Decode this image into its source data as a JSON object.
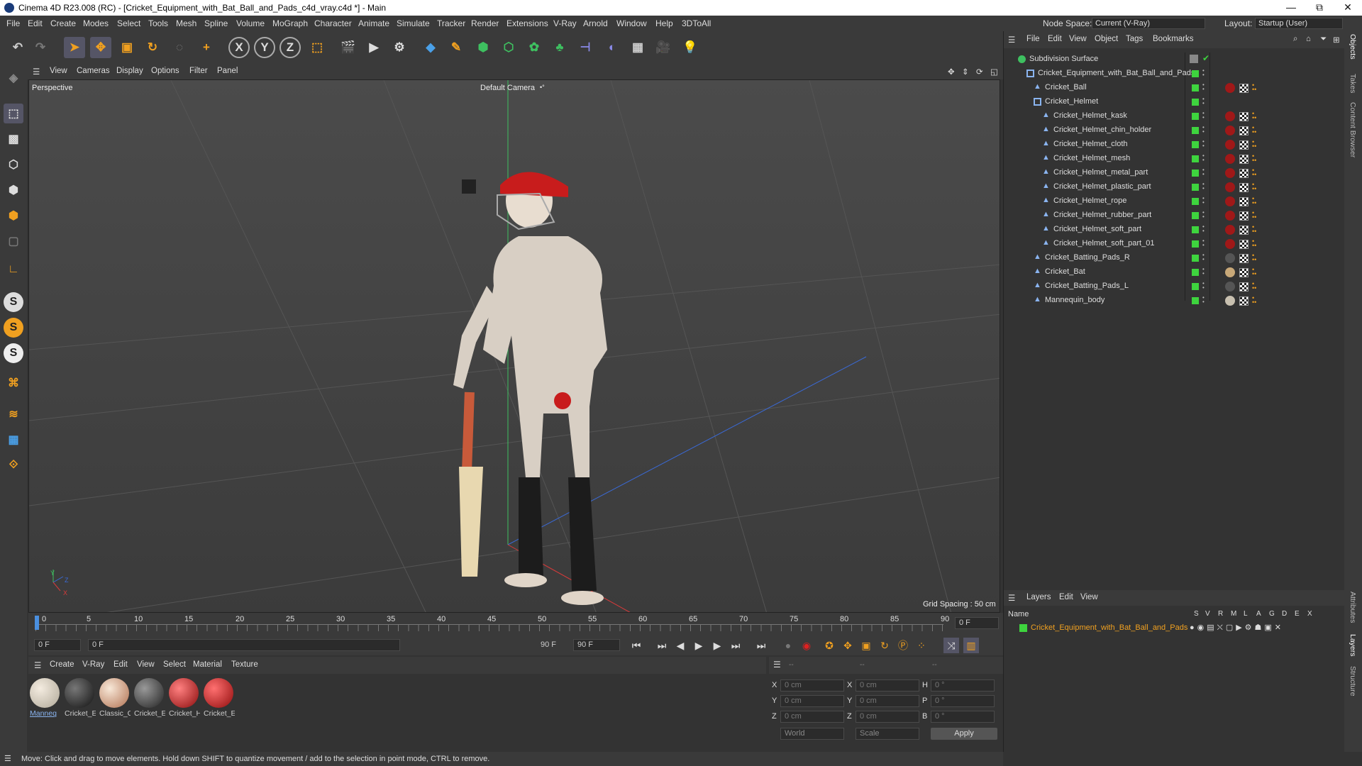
{
  "window": {
    "title": "Cinema 4D R23.008 (RC) - [Cricket_Equipment_with_Bat_Ball_and_Pads_c4d_vray.c4d *] - Main",
    "minimize": "—",
    "maximize": "⧉",
    "close": "✕"
  },
  "menu": {
    "items": [
      "File",
      "Edit",
      "Create",
      "Modes",
      "Select",
      "Tools",
      "Mesh",
      "Spline",
      "Volume",
      "MoGraph",
      "Character",
      "Animate",
      "Simulate",
      "Tracker",
      "Render",
      "Extensions",
      "V-Ray",
      "Arnold",
      "Window",
      "Help",
      "3DToAll"
    ],
    "node_space_label": "Node Space:",
    "node_space_value": "Current (V-Ray)",
    "layout_label": "Layout:",
    "layout_value": "Startup (User)"
  },
  "viewport": {
    "menu": [
      "View",
      "Cameras",
      "Display",
      "Options",
      "Filter",
      "Panel"
    ],
    "label": "Perspective",
    "camera": "Default Camera",
    "grid_spacing": "Grid Spacing : 50 cm",
    "axis_y": "Y",
    "axis_z": "Z",
    "axis_x": "X"
  },
  "timeline": {
    "ticks": [
      "0",
      "5",
      "10",
      "15",
      "20",
      "25",
      "30",
      "35",
      "40",
      "45",
      "50",
      "55",
      "60",
      "65",
      "70",
      "75",
      "80",
      "85",
      "90"
    ],
    "current_frame": "0 F"
  },
  "transport": {
    "start": "0 F",
    "range_start": "0 F",
    "range_end": "90 F",
    "end": "90 F"
  },
  "materials": {
    "menu": [
      "Create",
      "V-Ray",
      "Edit",
      "View",
      "Select",
      "Material",
      "Texture"
    ],
    "items": [
      {
        "label": "Manneq",
        "color": "#d8cfc0"
      },
      {
        "label": "Cricket_E",
        "color": "#2a2a2a"
      },
      {
        "label": "Classic_C",
        "color": "#e0c8b0"
      },
      {
        "label": "Cricket_E",
        "color": "#444"
      },
      {
        "label": "Cricket_H",
        "color": "#b01818"
      },
      {
        "label": "Cricket_E",
        "color": "#c02020"
      }
    ]
  },
  "coords": {
    "header_a": "--",
    "header_b": "--",
    "header_c": "--",
    "x_label": "X",
    "y_label": "Y",
    "z_label": "Z",
    "x2_label": "X",
    "y2_label": "Y",
    "z2_label": "Z",
    "h_label": "H",
    "p_label": "P",
    "b_label": "B",
    "x": "0 cm",
    "y": "0 cm",
    "z": "0 cm",
    "x2": "0 cm",
    "y2": "0 cm",
    "z2": "0 cm",
    "h": "0 °",
    "p": "0 °",
    "b": "0 °",
    "space": "World",
    "mode": "Scale",
    "apply": "Apply"
  },
  "status": "Move: Click and drag to move elements. Hold down SHIFT to quantize movement / add to the selection in point mode, CTRL to remove.",
  "objects": {
    "menu": [
      "File",
      "Edit",
      "View",
      "Object",
      "Tags",
      "Bookmarks"
    ],
    "rows": [
      {
        "name": "Subdivision Surface",
        "indent": 0,
        "tag": ""
      },
      {
        "name": "Cricket_Equipment_with_Bat_Ball_and_Pads",
        "indent": 1,
        "tag": ""
      },
      {
        "name": "Cricket_Ball",
        "indent": 2,
        "tag": "#a01818"
      },
      {
        "name": "Cricket_Helmet",
        "indent": 2,
        "tag": ""
      },
      {
        "name": "Cricket_Helmet_kask",
        "indent": 3,
        "tag": "#a01818"
      },
      {
        "name": "Cricket_Helmet_chin_holder",
        "indent": 3,
        "tag": "#a01818"
      },
      {
        "name": "Cricket_Helmet_cloth",
        "indent": 3,
        "tag": "#a01818"
      },
      {
        "name": "Cricket_Helmet_mesh",
        "indent": 3,
        "tag": "#a01818"
      },
      {
        "name": "Cricket_Helmet_metal_part",
        "indent": 3,
        "tag": "#a01818"
      },
      {
        "name": "Cricket_Helmet_plastic_part",
        "indent": 3,
        "tag": "#a01818"
      },
      {
        "name": "Cricket_Helmet_rope",
        "indent": 3,
        "tag": "#a01818"
      },
      {
        "name": "Cricket_Helmet_rubber_part",
        "indent": 3,
        "tag": "#a01818"
      },
      {
        "name": "Cricket_Helmet_soft_part",
        "indent": 3,
        "tag": "#a01818"
      },
      {
        "name": "Cricket_Helmet_soft_part_01",
        "indent": 3,
        "tag": "#a01818"
      },
      {
        "name": "Cricket_Batting_Pads_R",
        "indent": 2,
        "tag": "#555"
      },
      {
        "name": "Cricket_Bat",
        "indent": 2,
        "tag": "#c8a878"
      },
      {
        "name": "Cricket_Batting_Pads_L",
        "indent": 2,
        "tag": "#555"
      },
      {
        "name": "Mannequin_body",
        "indent": 2,
        "tag": "#c8c0b0"
      }
    ]
  },
  "layers": {
    "menu": [
      "Layers",
      "Edit",
      "View"
    ],
    "col_name": "Name",
    "cols": [
      "S",
      "V",
      "R",
      "M",
      "L",
      "A",
      "G",
      "D",
      "E",
      "X"
    ],
    "row": "Cricket_Equipment_with_Bat_Ball_and_Pads"
  },
  "side_tabs": [
    "Objects",
    "Takes",
    "Content Browser",
    "Attributes",
    "Layers",
    "Structure"
  ]
}
